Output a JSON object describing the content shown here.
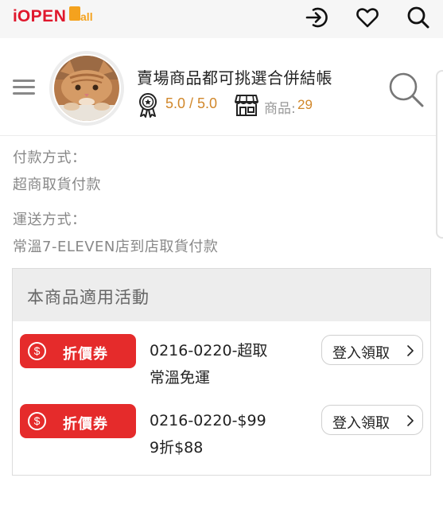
{
  "app": {
    "logo_i": "i",
    "logo_open": "OPEN",
    "logo_mall": "Mall",
    "icons": [
      "login-icon",
      "heart-icon",
      "search-icon"
    ]
  },
  "store": {
    "name": "賣場商品都可挑選合併結帳",
    "rating": "5.0 / 5.0",
    "products_label": "商品:",
    "products_count": "29",
    "icons": [
      "menu-icon",
      "award-badge-icon",
      "shop-icon",
      "search-icon"
    ]
  },
  "payment": {
    "label": "付款方式：",
    "value": "超商取貨付款"
  },
  "shipping": {
    "label": "運送方式：",
    "value": "常溫7-ELEVEN店到店取貨付款"
  },
  "promotions": {
    "title": "本商品適用活動",
    "items": [
      {
        "coupon_label": "折價券",
        "desc_line1": "0216-0220-超取",
        "desc_line2": "常溫免運",
        "button": "登入領取"
      },
      {
        "coupon_label": "折價券",
        "desc_line1": "0216-0220-$99",
        "desc_line2": "9折$88",
        "button": "登入領取"
      }
    ]
  },
  "colors": {
    "brand_red": "#e0182d",
    "mall_orange": "#f4a21e",
    "rating_orange": "#d1872a",
    "coupon_red": "#e52b2b"
  }
}
